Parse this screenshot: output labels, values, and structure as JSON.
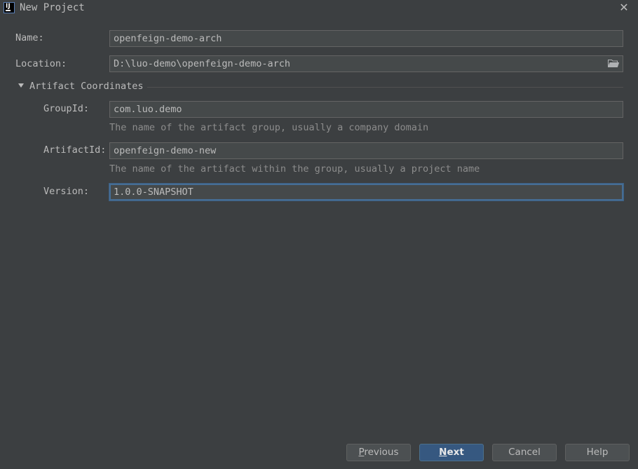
{
  "window": {
    "title": "New Project",
    "app_icon": "intellij-idea-icon",
    "close_icon": "close-icon"
  },
  "form": {
    "name": {
      "label": "Name:",
      "value": "openfeign-demo-arch"
    },
    "location": {
      "label": "Location:",
      "value": "D:\\luo-demo\\openfeign-demo-arch",
      "icon": "folder-icon"
    },
    "artifact_section": {
      "label": "Artifact Coordinates",
      "expanded": true,
      "groupid": {
        "label": "GroupId:",
        "value": "com.luo.demo",
        "hint": "The name of the artifact group, usually a company domain"
      },
      "artifactid": {
        "label": "ArtifactId:",
        "value": "openfeign-demo-new",
        "hint": "The name of the artifact within the group, usually a project name"
      },
      "version": {
        "label": "Version:",
        "value": "1.0.0-SNAPSHOT",
        "focused": true
      }
    }
  },
  "buttons": {
    "previous": {
      "mnemonic": "P",
      "rest": "revious"
    },
    "next": {
      "mnemonic": "N",
      "rest": "ext"
    },
    "cancel": {
      "label": "Cancel"
    },
    "help": {
      "label": "Help"
    }
  },
  "colors": {
    "background": "#3c3f41",
    "field_bg": "#45494a",
    "focus_border": "#466d94",
    "primary_button": "#365880",
    "hint_text": "#8c8c8c"
  }
}
